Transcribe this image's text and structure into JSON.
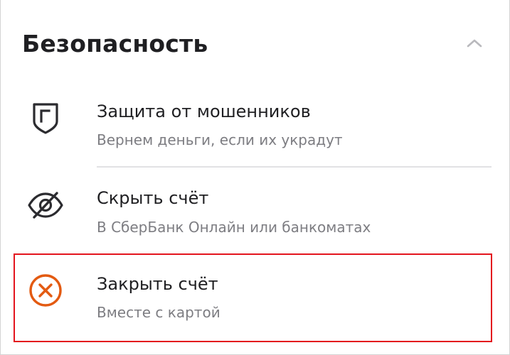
{
  "section": {
    "title": "Безопасность",
    "collapse_icon": "chevron-up-icon"
  },
  "items": [
    {
      "label": "Защита от мошенников",
      "subtitle": "Вернем деньги, если их украдут",
      "icon": "shield-icon"
    },
    {
      "label": "Скрыть счёт",
      "subtitle": "В СберБанк Онлайн или банкоматах",
      "icon": "eye-off-icon"
    },
    {
      "label": "Закрыть счёт",
      "subtitle": "Вместе с картой",
      "icon": "close-circle-icon",
      "highlighted": true
    }
  ],
  "colors": {
    "close_icon": "#e35a11",
    "highlight_border": "#e3141d",
    "text_primary": "#1f1f22",
    "text_secondary": "#7d7d82"
  }
}
